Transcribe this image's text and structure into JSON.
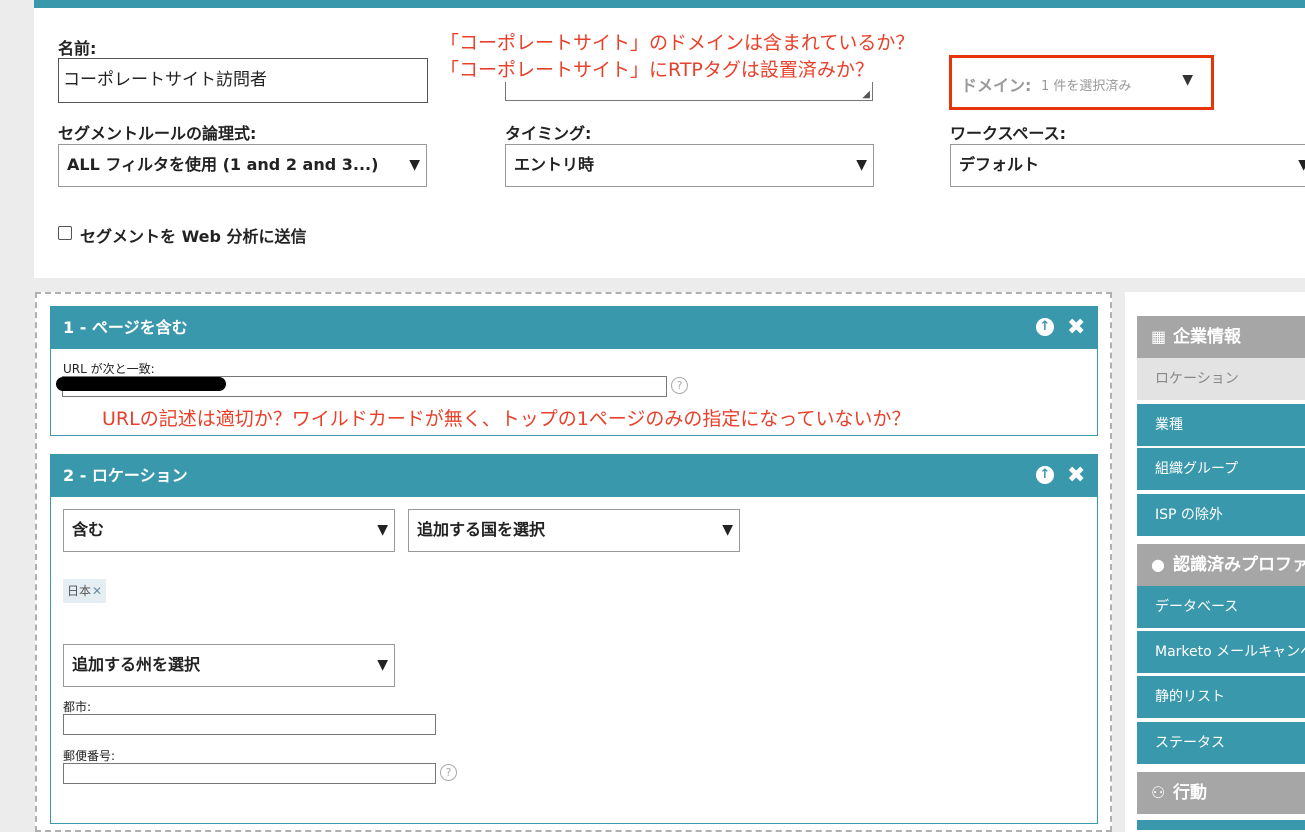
{
  "form": {
    "name_label": "名前:",
    "name_value": "コーポレートサイト訪問者",
    "domain_label": "ドメイン:",
    "domain_value": "1 件を選択済み",
    "segment_rule_label": "セグメントルールの論理式:",
    "segment_rule_value": "ALL フィルタを使用 (1 and 2 and 3...)",
    "timing_label": "タイミング:",
    "timing_value": "エントリ時",
    "workspace_label": "ワークスペース:",
    "workspace_value": "デフォルト",
    "send_checkbox_label": "セグメントを Web 分析に送信"
  },
  "annotations": {
    "line1": "「コーポレートサイト」のドメインは含まれているか？",
    "line2": "「コーポレートサイト」にRTPタグは設置済みか？",
    "url_note": "URLの記述は適切か？ワイルドカードが無く、トップの1ページのみの指定になっていないか？"
  },
  "cards": {
    "card1": {
      "title": "1 - ページを含む",
      "url_label": "URL が次と一致:"
    },
    "card2": {
      "title": "2 - ロケーション",
      "include_value": "含む",
      "country_placeholder": "追加する国を選択",
      "country_tag": "日本",
      "state_placeholder": "追加する州を選択",
      "city_label": "都市:",
      "zip_label": "郵便番号:"
    }
  },
  "sidebar": {
    "group1_title": "企業情報",
    "group1_items": [
      "ロケーション",
      "業種",
      "組織グループ",
      "ISP の除外"
    ],
    "group2_title": "認識済みプロファ",
    "group2_items": [
      "データベース",
      "Marketo メールキャンペー",
      "静的リスト",
      "ステータス"
    ],
    "group3_title": "行動"
  },
  "colors": {
    "accent": "#3a98ad",
    "annotation_red": "#e8402a",
    "sidebar_header": "#a6a6a6"
  }
}
